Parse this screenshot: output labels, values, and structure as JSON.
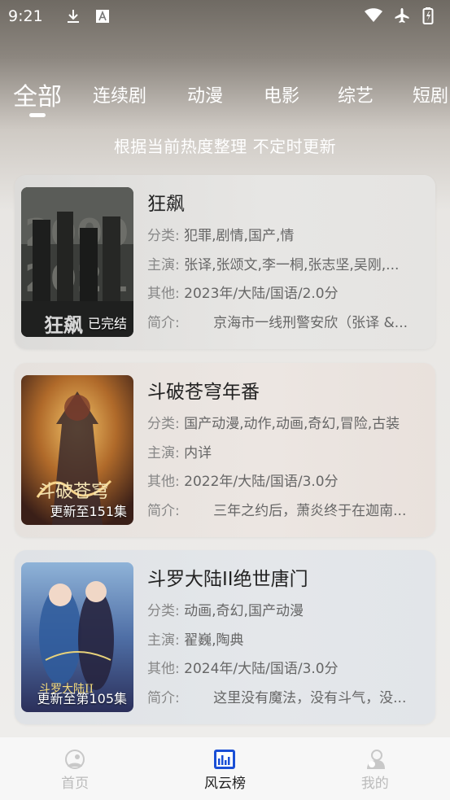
{
  "status_bar": {
    "time": "9:21",
    "left_icons": [
      "download-icon",
      "a-box-icon"
    ],
    "right_icons": [
      "wifi-icon",
      "airplane-icon",
      "battery-icon"
    ]
  },
  "tabs": [
    {
      "label": "全部",
      "active": true
    },
    {
      "label": "连续剧",
      "active": false
    },
    {
      "label": "动漫",
      "active": false
    },
    {
      "label": "电影",
      "active": false
    },
    {
      "label": "综艺",
      "active": false
    },
    {
      "label": "短剧",
      "active": false
    }
  ],
  "subtitle": "根据当前热度整理 不定时更新",
  "labels": {
    "category": "分类:",
    "cast": "主演:",
    "other": "其他:",
    "intro": "简介:"
  },
  "cards": [
    {
      "title": "狂飙",
      "badge": "已完结",
      "category": "犯罪,剧情,国产,情",
      "cast": "张译,张颂文,李一桐,张志坚,吴刚,...",
      "other": "2023年/大陆/国语/2.0分",
      "intro": "京海市一线刑警安欣（张译 &...",
      "poster_icon": "poster-kuangbiao"
    },
    {
      "title": "斗破苍穹年番",
      "badge": "更新至151集",
      "category": "国产动漫,动作,动画,奇幻,冒险,古装",
      "cast": "内详",
      "other": "2022年/大陆/国语/3.0分",
      "intro": "三年之约后，萧炎终于在迦南...",
      "poster_icon": "poster-doupo"
    },
    {
      "title": "斗罗大陆II绝世唐门",
      "badge": "更新至第105集",
      "category": "动画,奇幻,国产动漫",
      "cast": "翟巍,陶典",
      "other": "2024年/大陆/国语/3.0分",
      "intro": "这里没有魔法，没有斗气，没...",
      "poster_icon": "poster-douluo"
    }
  ],
  "bottom_nav": [
    {
      "label": "首页",
      "icon": "home-icon",
      "active": false
    },
    {
      "label": "风云榜",
      "icon": "chart-icon",
      "active": true
    },
    {
      "label": "我的",
      "icon": "profile-icon",
      "active": false
    }
  ],
  "colors": {
    "accent": "#1a4fd6",
    "inactive_nav": "#bbbbbb",
    "active_nav": "#222222"
  }
}
